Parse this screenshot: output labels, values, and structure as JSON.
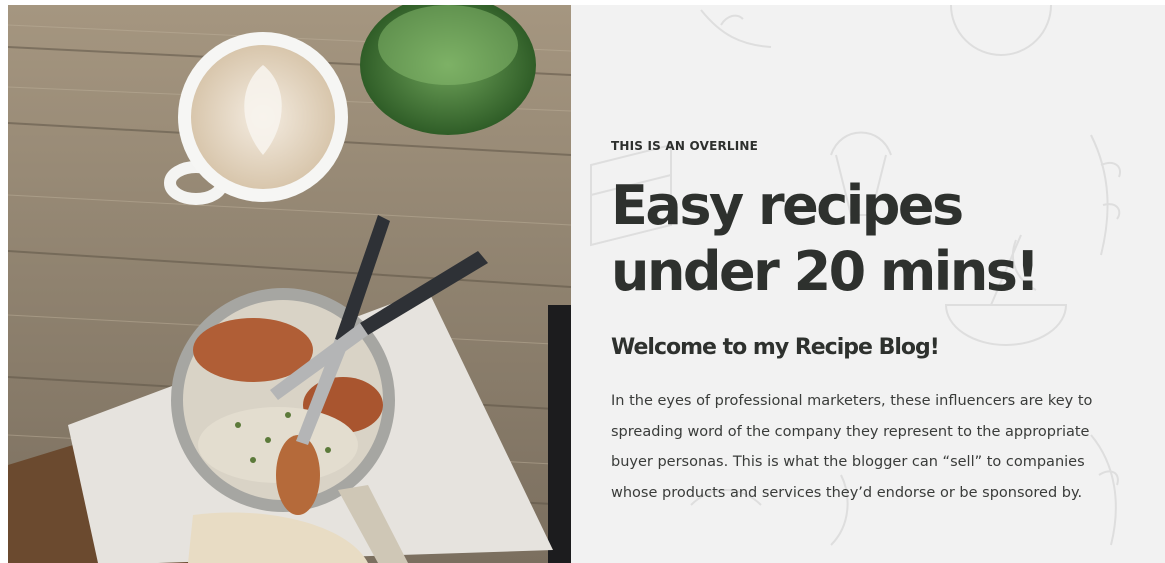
{
  "hero": {
    "overline": "THIS IS AN OVERLINE",
    "headline": "Easy recipes under 20 mins!",
    "subheading": "Welcome to my Recipe Blog!",
    "body": "In the eyes of professional marketers, these influencers are key to spreading word of the company they represent to the appropriate buyer personas. This is what the blogger can “sell” to companies whose products and services they’d endorse or be sponsored by."
  },
  "colors": {
    "panel_background": "#f2f2f2",
    "text_dark": "#2e312e",
    "wood": "#9a8a74",
    "paper": "#e9e7e3"
  },
  "icons": [
    "food-doodle-pattern"
  ]
}
